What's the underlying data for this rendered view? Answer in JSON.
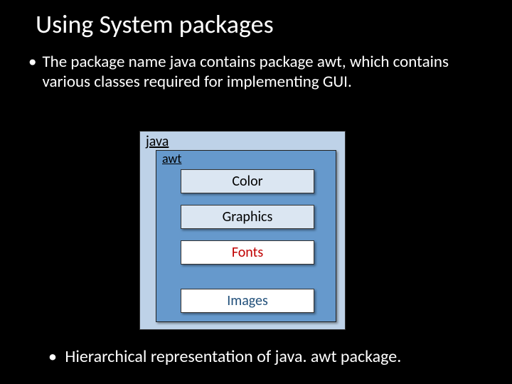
{
  "title": "Using System packages",
  "bullet_top": "The package name java contains package awt, which contains various classes required for implementing GUI.",
  "bullet_bottom": "Hierarchical representation of java. awt package.",
  "diagram": {
    "java_label": "java",
    "awt_label": "awt",
    "items": [
      "Color",
      "Graphics",
      "Fonts",
      "Images"
    ]
  }
}
